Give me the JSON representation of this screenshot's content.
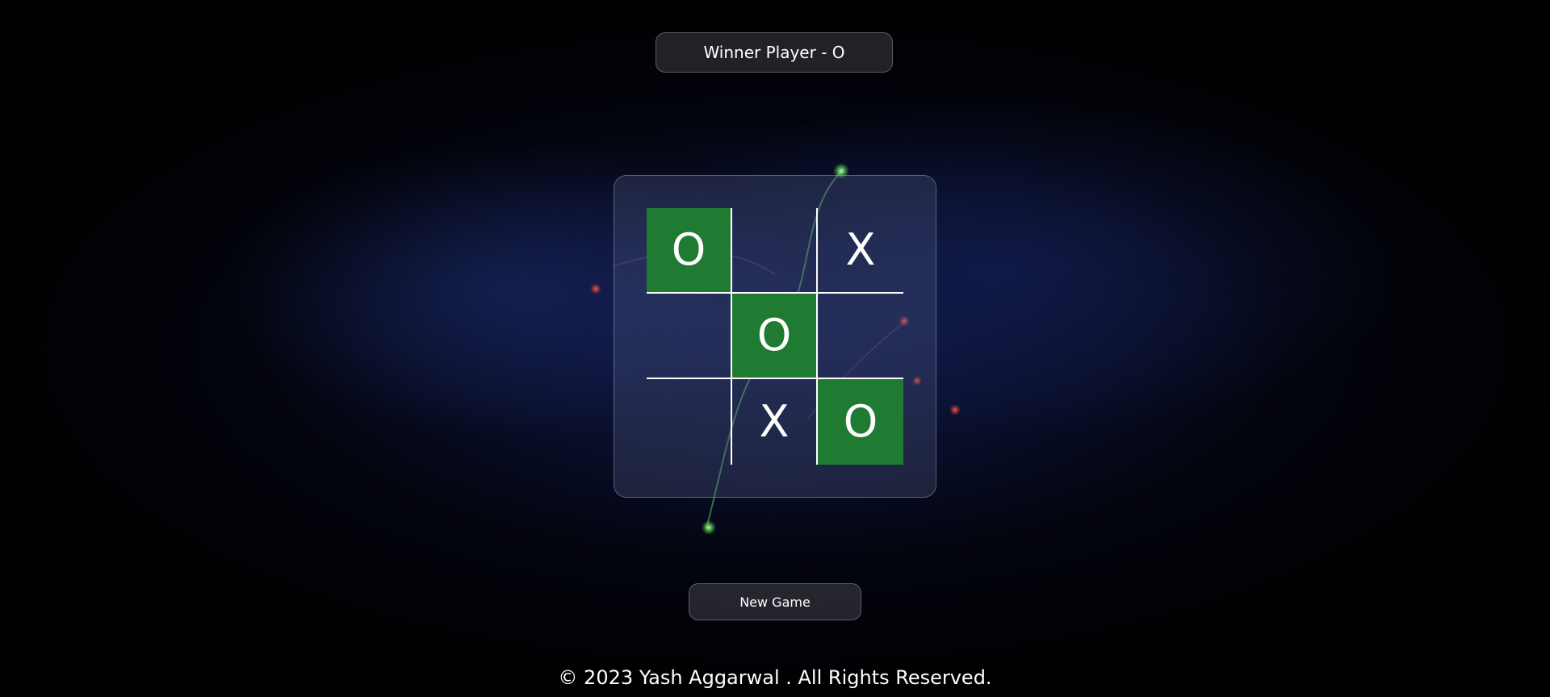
{
  "status": {
    "text": "Winner Player - O"
  },
  "board": {
    "cells": [
      {
        "value": "O",
        "winning": true
      },
      {
        "value": "",
        "winning": false
      },
      {
        "value": "X",
        "winning": false
      },
      {
        "value": "",
        "winning": false
      },
      {
        "value": "O",
        "winning": true
      },
      {
        "value": "",
        "winning": false
      },
      {
        "value": "",
        "winning": false
      },
      {
        "value": "X",
        "winning": false
      },
      {
        "value": "O",
        "winning": true
      }
    ]
  },
  "controls": {
    "new_game_label": "New Game"
  },
  "footer": {
    "text": "© 2023 Yash Aggarwal . All Rights Reserved."
  },
  "colors": {
    "win_cell": "#1f7a32",
    "grid_line": "#ffffff",
    "text": "#ffffff"
  }
}
